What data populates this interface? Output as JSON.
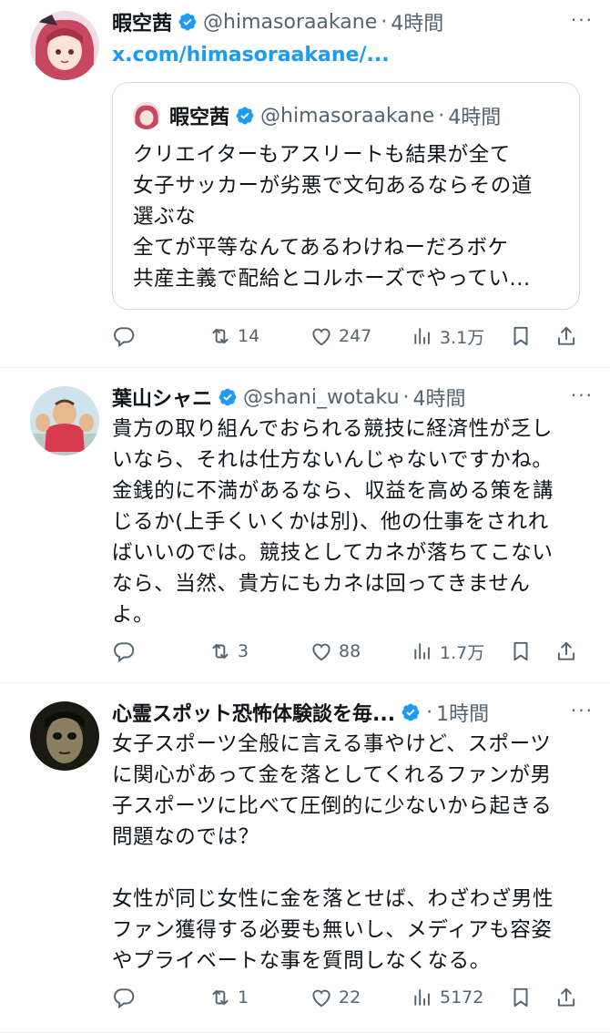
{
  "tweets": [
    {
      "name": "暇空茜",
      "handle": "@himasoraakane",
      "time": "4時間",
      "link": "x.com/himasoraakane/...",
      "quote": {
        "name": "暇空茜",
        "handle": "@himasoraakane",
        "time": "4時間",
        "text": "クリエイターもアスリートも結果が全て\n女子サッカーが劣悪で文句あるならその道\n選ぶな\n全てが平等なんてあるわけねーだろボケ\n共産主義で配給とコルホーズでやってい..."
      },
      "reply_count": "",
      "retweets": "14",
      "likes": "247",
      "views": "3.1万"
    },
    {
      "name": "葉山シャニ",
      "handle": "@shani_wotaku",
      "time": "4時間",
      "text": "貴方の取り組んでおられる競技に経済性が乏し\nいなら、それは仕方ないんじゃないですかね。\n金銭的に不満があるなら、収益を高める策を講\nじるか(上手くいくかは別)、他の仕事をされれ\nばいいのでは。競技としてカネが落ちてこない\nなら、当然、貴方にもカネは回ってきません\nよ。",
      "retweets": "3",
      "likes": "88",
      "views": "1.7万"
    },
    {
      "name": "心霊スポット恐怖体験談を毎...",
      "handle": "",
      "time": "1時間",
      "text": "女子スポーツ全般に言える事やけど、スポーツ\nに関心があって金を落としてくれるファンが男\n子スポーツに比べて圧倒的に少ないから起きる\n問題なのでは？\n\n女性が同じ女性に金を落とせば、わざわざ男性\nファン獲得する必要も無いし、メディアも容姿\nやプライベートな事を質問しなくなる。",
      "retweets": "1",
      "likes": "22",
      "views": "5172"
    }
  ],
  "separator": "·",
  "more_label": "···",
  "colors": {
    "verified": "#1d9bf0",
    "link": "#1d9bf0",
    "secondary": "#536471"
  },
  "icons": [
    "reply-icon",
    "retweet-icon",
    "like-icon",
    "views-icon",
    "bookmark-icon",
    "share-icon"
  ]
}
